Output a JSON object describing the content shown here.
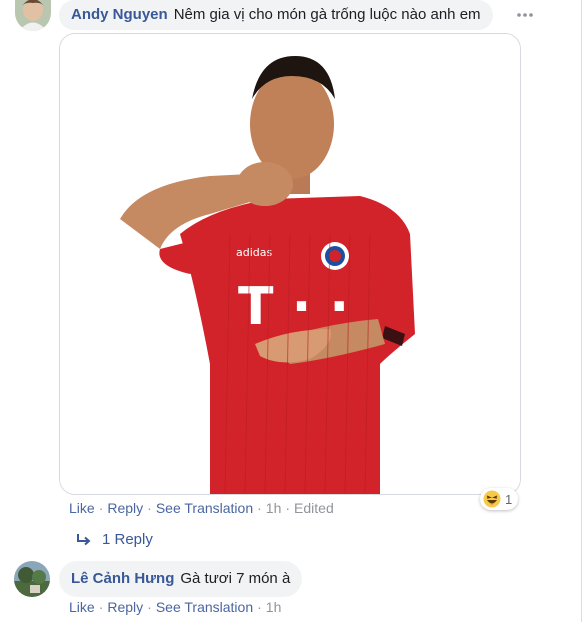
{
  "comment1": {
    "author": "Andy Nguyen",
    "text": "Nêm gia vị cho món gà trống luộc nào anh em",
    "more_icon": "ellipsis-icon",
    "actions": {
      "like": "Like",
      "reply": "Reply",
      "see_translation": "See Translation",
      "time": "1h",
      "edited": "Edited"
    },
    "attachment": {
      "type": "gif",
      "jersey_text": "T · ·",
      "sponsor_text": "adidas"
    },
    "reactions": {
      "icon": "haha-emoji-icon",
      "count": "1"
    },
    "replies": {
      "icon": "reply-arrow-icon",
      "label": "1 Reply"
    }
  },
  "comment2": {
    "author": "Lê Cảnh Hưng",
    "text": "Gà tươi 7 món à",
    "actions": {
      "like": "Like",
      "reply": "Reply",
      "see_translation": "See Translation",
      "time": "1h"
    }
  },
  "colors": {
    "author_link": "#385898",
    "bubble_bg": "#f2f3f5",
    "action_link": "#4a66a0",
    "muted": "#90949c",
    "jersey_red": "#d3232a"
  }
}
